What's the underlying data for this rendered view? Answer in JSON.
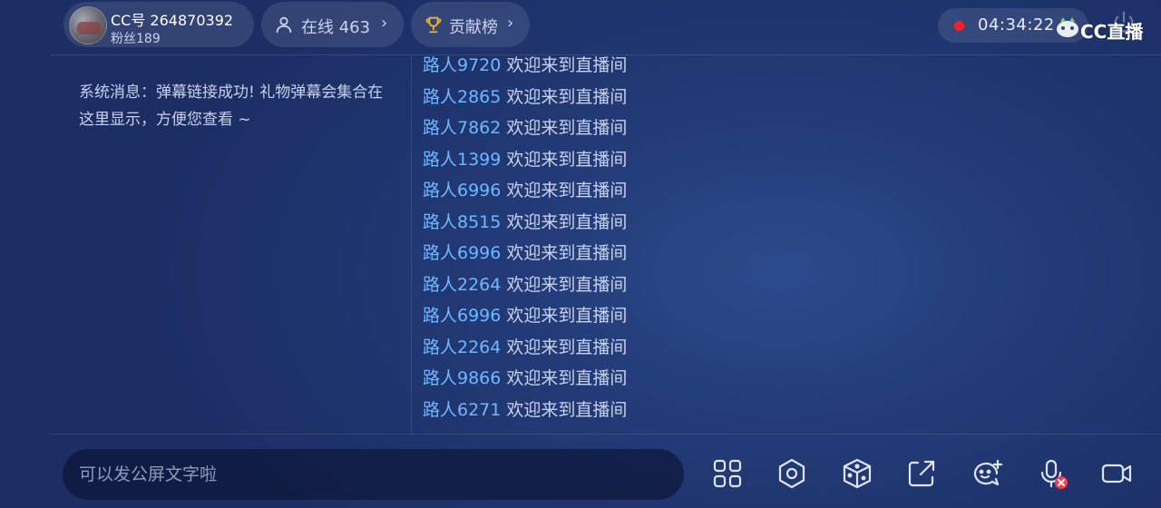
{
  "header": {
    "profile": {
      "cc_id": "CC号 264870392",
      "fans": "粉丝189"
    },
    "online": {
      "label": "在线 463",
      "chevron": "›",
      "icon": "person-icon"
    },
    "contribution": {
      "label": "贡献榜",
      "chevron": "›",
      "icon": "trophy-icon"
    },
    "timer": {
      "time": "04:34:22",
      "status_color": "#ff1d25"
    },
    "brand": {
      "text": "CC直播"
    }
  },
  "system_message": "系统消息：弹幕链接成功! 礼物弹幕会集合在这里显示，方便您查看 ~",
  "messages": [
    {
      "user": "路人9720",
      "text": "欢迎来到直播间"
    },
    {
      "user": "路人2865",
      "text": "欢迎来到直播间"
    },
    {
      "user": "路人7862",
      "text": "欢迎来到直播间"
    },
    {
      "user": "路人1399",
      "text": "欢迎来到直播间"
    },
    {
      "user": "路人6996",
      "text": "欢迎来到直播间"
    },
    {
      "user": "路人8515",
      "text": "欢迎来到直播间"
    },
    {
      "user": "路人6996",
      "text": "欢迎来到直播间"
    },
    {
      "user": "路人2264",
      "text": "欢迎来到直播间"
    },
    {
      "user": "路人6996",
      "text": "欢迎来到直播间"
    },
    {
      "user": "路人2264",
      "text": "欢迎来到直播间"
    },
    {
      "user": "路人9866",
      "text": "欢迎来到直播间"
    },
    {
      "user": "路人6271",
      "text": "欢迎来到直播间"
    }
  ],
  "input": {
    "placeholder": "可以发公屏文字啦",
    "value": ""
  },
  "toolbar": [
    "grid-icon",
    "settings-icon",
    "dice-icon",
    "share-icon",
    "chat-add-icon",
    "mic-muted-icon",
    "video-camera-icon"
  ],
  "colors": {
    "username": "#6fb8ff",
    "message": "#c8d1ea",
    "record": "#ff1d25",
    "mute_badge": "#ff3b4b"
  }
}
